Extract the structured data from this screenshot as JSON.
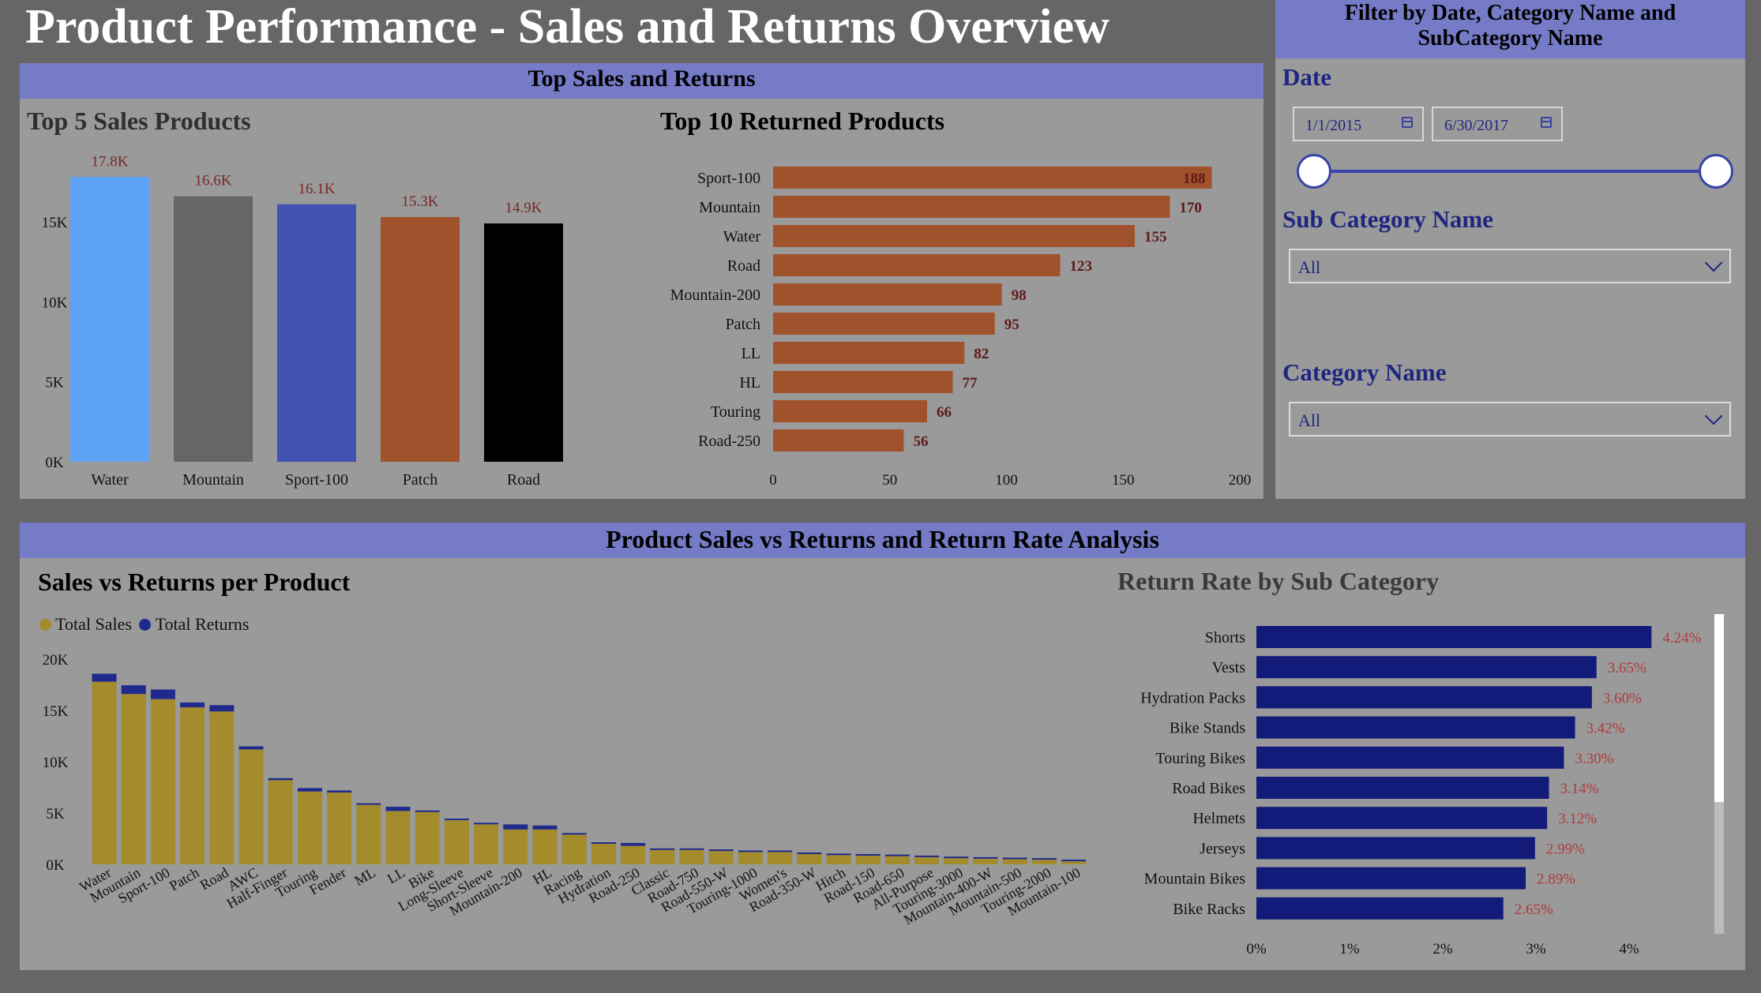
{
  "page": {
    "title": "Product Performance - Sales and Returns Overview"
  },
  "filters": {
    "header": [
      "Filter by Date, Category Name and",
      "SubCategory Name"
    ],
    "date_label": "Date",
    "date_start": "1/1/2015",
    "date_end": "6/30/2017",
    "subcategory_label": "Sub Category Name",
    "subcategory_value": "All",
    "category_label": "Category Name",
    "category_value": "All"
  },
  "sections": {
    "top": "Top Sales and Returns",
    "bottom": "Product Sales vs Returns and Return Rate Analysis"
  },
  "chart_data": [
    {
      "id": "top5",
      "type": "bar",
      "title": "Top 5 Sales Products",
      "categories": [
        "Water",
        "Mountain",
        "Sport-100",
        "Patch",
        "Road"
      ],
      "values": [
        17800,
        16600,
        16100,
        15300,
        14900
      ],
      "data_labels": [
        "17.8K",
        "16.6K",
        "16.1K",
        "15.3K",
        "14.9K"
      ],
      "colors": [
        "#5ea2f6",
        "#666666",
        "#4351b0",
        "#a0522d",
        "#000000"
      ],
      "yticks": [
        "0K",
        "5K",
        "10K",
        "15K"
      ],
      "ylim": [
        0,
        19000
      ]
    },
    {
      "id": "top10returns",
      "type": "bar",
      "orientation": "horizontal",
      "title": "Top 10 Returned Products",
      "categories": [
        "Sport-100",
        "Mountain",
        "Water",
        "Road",
        "Mountain-200",
        "Patch",
        "LL",
        "HL",
        "Touring",
        "Road-250"
      ],
      "values": [
        188,
        170,
        155,
        123,
        98,
        95,
        82,
        77,
        66,
        56
      ],
      "color": "#a0522d",
      "xticks": [
        "0",
        "50",
        "100",
        "150",
        "200"
      ],
      "xlim": [
        0,
        200
      ]
    },
    {
      "id": "salesvsreturns",
      "type": "bar",
      "stacked": true,
      "title": "Sales vs Returns per Product",
      "legend": [
        "Total Sales",
        "Total Returns"
      ],
      "legend_colors": [
        "#a48b2c",
        "#1f2a8c"
      ],
      "categories": [
        "Water",
        "Mountain",
        "Sport-100",
        "Patch",
        "Road",
        "AWC",
        "Half-Finger",
        "Touring",
        "Fender",
        "ML",
        "LL",
        "Bike",
        "Long-Sleeve",
        "Short-Sleeve",
        "Mountain-200",
        "HL",
        "Racing",
        "Hydration",
        "Road-250",
        "Classic",
        "Road-750",
        "Road-550-W",
        "Touring-1000",
        "Women's",
        "Road-350-W",
        "Hitch",
        "Road-150",
        "Road-650",
        "All-Purpose",
        "Touring-3000",
        "Mountain-400-W",
        "Mountain-500",
        "Touring-2000",
        "Mountain-100"
      ],
      "series": [
        {
          "name": "Total Sales",
          "values": [
            17800,
            16600,
            16100,
            15300,
            14900,
            11200,
            8200,
            7100,
            7000,
            5800,
            5200,
            5100,
            4300,
            3900,
            3400,
            3400,
            2900,
            2000,
            1800,
            1400,
            1400,
            1300,
            1200,
            1200,
            1000,
            900,
            850,
            800,
            700,
            600,
            550,
            500,
            450,
            300
          ]
        },
        {
          "name": "Total Returns",
          "values": [
            155,
            170,
            188,
            95,
            123,
            60,
            40,
            66,
            40,
            30,
            82,
            25,
            25,
            20,
            98,
            77,
            15,
            15,
            56,
            10,
            12,
            10,
            12,
            8,
            10,
            5,
            8,
            8,
            5,
            5,
            5,
            5,
            5,
            5
          ]
        }
      ],
      "yticks": [
        "0K",
        "5K",
        "10K",
        "15K",
        "20K"
      ],
      "ylim": [
        0,
        20000
      ]
    },
    {
      "id": "returnrate",
      "type": "bar",
      "orientation": "horizontal",
      "title": "Return Rate by Sub Category",
      "categories": [
        "Shorts",
        "Vests",
        "Hydration Packs",
        "Bike Stands",
        "Touring Bikes",
        "Road Bikes",
        "Helmets",
        "Jerseys",
        "Mountain Bikes",
        "Bike Racks"
      ],
      "values": [
        4.24,
        3.65,
        3.6,
        3.42,
        3.3,
        3.14,
        3.12,
        2.99,
        2.89,
        2.65
      ],
      "data_labels": [
        "4.24%",
        "3.65%",
        "3.60%",
        "3.42%",
        "3.30%",
        "3.14%",
        "3.12%",
        "2.99%",
        "2.89%",
        "2.65%"
      ],
      "color": "#121a7a",
      "xticks": [
        "0%",
        "1%",
        "2%",
        "3%",
        "4%"
      ],
      "xlim": [
        0,
        4.5
      ]
    }
  ]
}
